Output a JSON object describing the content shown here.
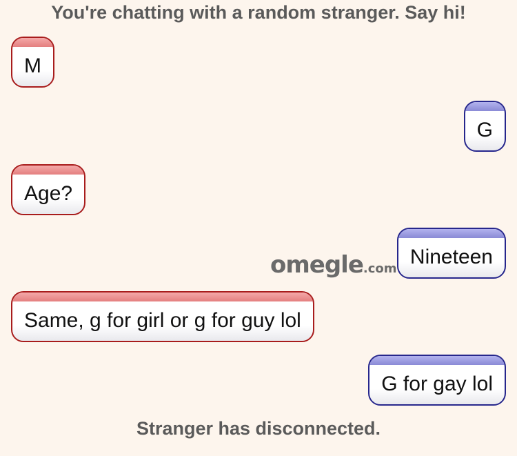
{
  "header": {
    "status": "You're chatting with a random stranger. Say hi!"
  },
  "logo": {
    "main": "omegle",
    "tld": ".com"
  },
  "messages": [
    {
      "sender": "stranger",
      "text": "M"
    },
    {
      "sender": "you",
      "text": "G"
    },
    {
      "sender": "stranger",
      "text": "Age?"
    },
    {
      "sender": "you",
      "text": "Nineteen"
    },
    {
      "sender": "stranger",
      "text": "Same, g for girl or g for guy lol"
    },
    {
      "sender": "you",
      "text": "G for gay lol"
    }
  ],
  "footer": {
    "status": "Stranger has disconnected."
  },
  "colors": {
    "background": "#fdf5ed",
    "stranger_border": "#a81c1c",
    "you_border": "#26268c",
    "status_text": "#5a5a5a"
  }
}
